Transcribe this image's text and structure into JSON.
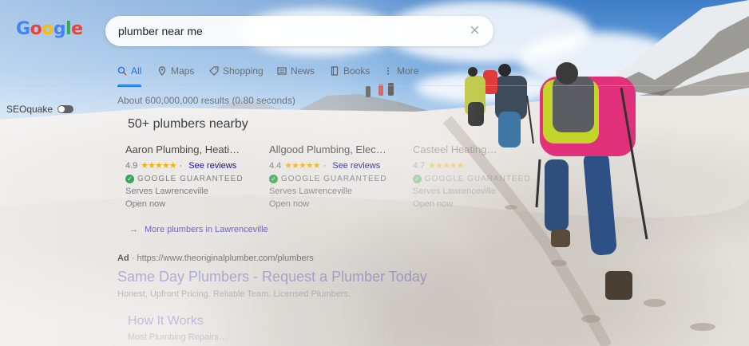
{
  "logo": {
    "letters": [
      "G",
      "o",
      "o",
      "g",
      "l",
      "e"
    ]
  },
  "search": {
    "query": "plumber near me"
  },
  "tabs": [
    {
      "label": "All",
      "icon": "search-icon",
      "active": true
    },
    {
      "label": "Maps",
      "icon": "map-pin-icon"
    },
    {
      "label": "Shopping",
      "icon": "tag-icon"
    },
    {
      "label": "News",
      "icon": "news-icon"
    },
    {
      "label": "Books",
      "icon": "book-icon"
    },
    {
      "label": "More",
      "icon": "more-vert-icon"
    }
  ],
  "seoquake": {
    "label": "SEOquake"
  },
  "result_stats": "About 600,000,000 results (0.80 seconds)",
  "local": {
    "title": "50+ plumbers nearby",
    "cards": [
      {
        "name": "Aaron Plumbing, Heati…",
        "rating": "4.9",
        "stars": "★★★★★",
        "reviews": "See reviews",
        "badge": "GOOGLE GUARANTEED",
        "serves": "Serves Lawrenceville",
        "hours": "Open now"
      },
      {
        "name": "Allgood Plumbing, Elec…",
        "rating": "4.4",
        "stars": "★★★★★",
        "reviews": "See reviews",
        "badge": "GOOGLE GUARANTEED",
        "serves": "Serves Lawrenceville",
        "hours": "Open now"
      },
      {
        "name": "Casteel Heating…",
        "rating": "4.7",
        "stars": "★★★★★",
        "reviews": "",
        "badge": "GOOGLE GUARANTEED",
        "serves": "Serves Lawrenceville",
        "hours": "Open now"
      }
    ],
    "more_link": "More plumbers in Lawrenceville"
  },
  "ad": {
    "label": "Ad",
    "url": "https://www.theoriginalplumber.com/plumbers",
    "title": "Same Day Plumbers - Request a Plumber Today",
    "description": "Honest, Upfront Pricing. Reliable Team. Licensed Plumbers.",
    "sitelink": "How It Works",
    "sitelink_desc": "Most Plumbing Repairs…"
  },
  "colors": {
    "accent": "#1a73e8",
    "link": "#1a0dab",
    "star": "#f4b400",
    "check": "#34a853"
  }
}
